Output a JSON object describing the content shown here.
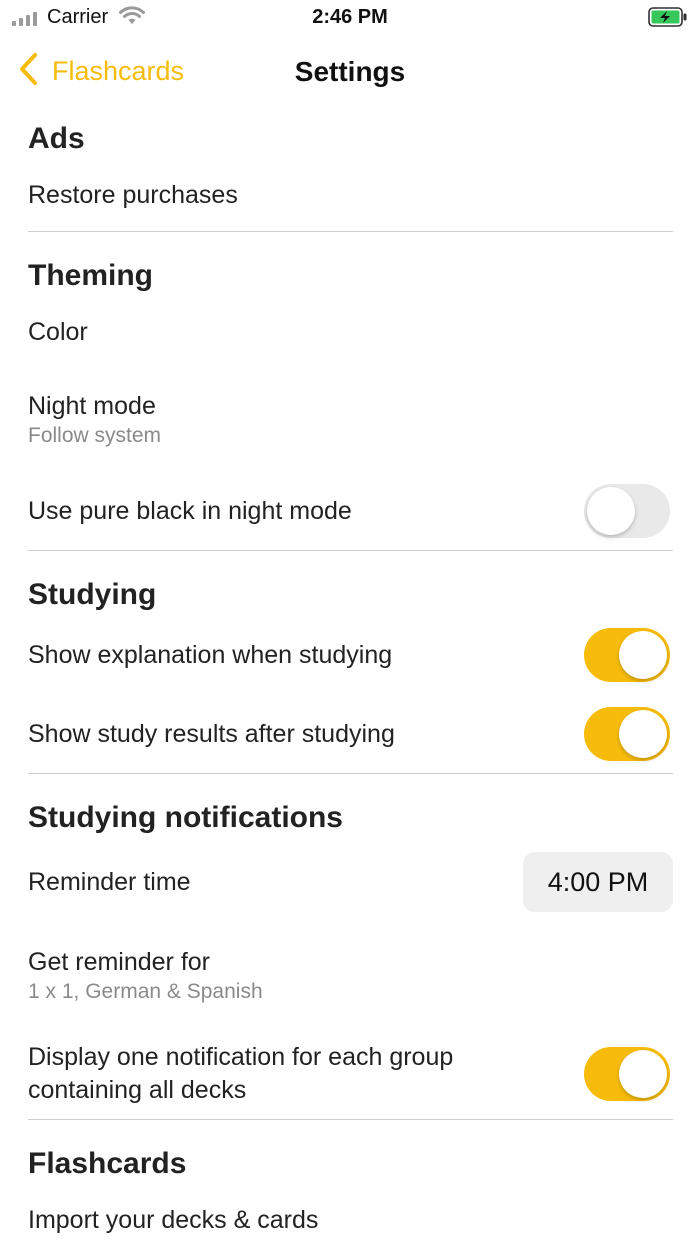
{
  "status_bar": {
    "carrier": "Carrier",
    "time": "2:46 PM",
    "signal_icon": "signal-bars-icon",
    "wifi_icon": "wifi-icon",
    "battery_icon": "battery-charging-icon"
  },
  "nav": {
    "back_label": "Flashcards",
    "title": "Settings",
    "accent_color": "#F7BC0B"
  },
  "sections": {
    "ads": {
      "header": "Ads",
      "restore": "Restore purchases"
    },
    "theming": {
      "header": "Theming",
      "color": "Color",
      "night_mode": "Night mode",
      "night_mode_value": "Follow system",
      "pure_black": "Use pure black in night mode",
      "pure_black_on": false
    },
    "studying": {
      "header": "Studying",
      "show_explanation": "Show explanation when studying",
      "show_explanation_on": true,
      "show_results": "Show study results after studying",
      "show_results_on": true
    },
    "notifications": {
      "header": "Studying notifications",
      "reminder_time": "Reminder time",
      "reminder_time_value": "4:00 PM",
      "get_reminder": "Get reminder for",
      "get_reminder_value": "1 x 1, German & Spanish",
      "one_notification_line1": "Display one notification for each group",
      "one_notification_line2": "containing all decks",
      "one_notification_on": true
    },
    "flashcards": {
      "header": "Flashcards",
      "import": "Import your decks & cards"
    }
  }
}
